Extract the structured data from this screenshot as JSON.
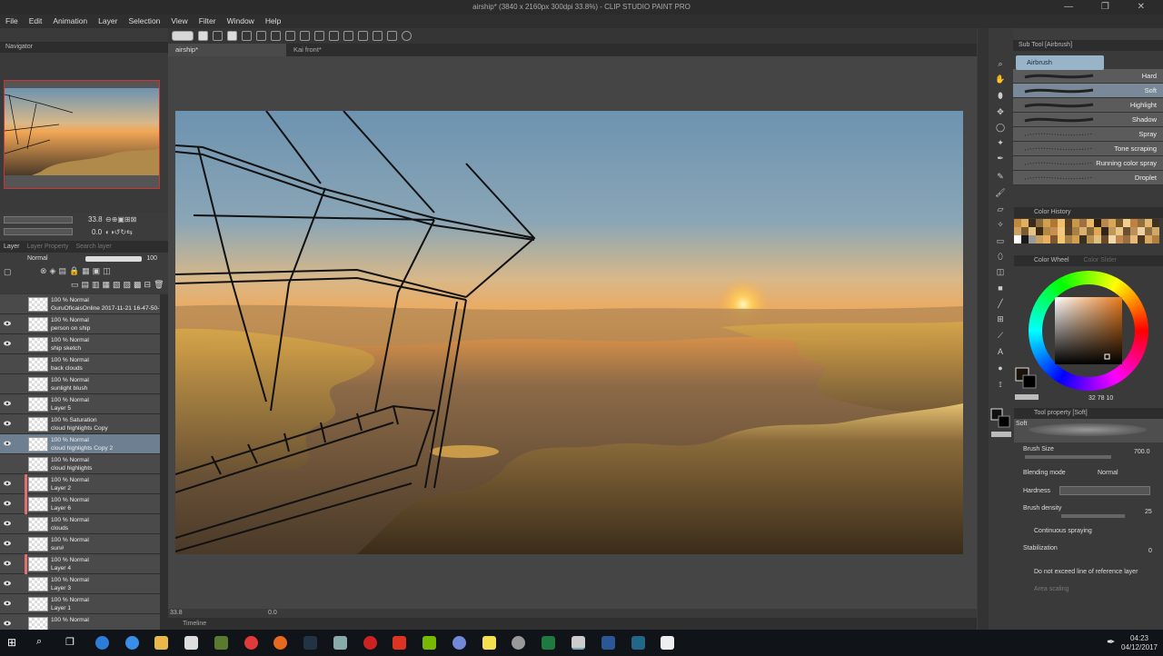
{
  "window": {
    "title": "airship* (3840 x 2160px 300dpi 33.8%) - CLIP STUDIO PAINT PRO",
    "controls": "— ❐ ✕"
  },
  "menu": [
    "File",
    "Edit",
    "Animation",
    "Layer",
    "Selection",
    "View",
    "Filter",
    "Window",
    "Help"
  ],
  "doc_tabs": [
    {
      "label": "airship*",
      "active": true
    },
    {
      "label": "Kai front*",
      "active": false
    }
  ],
  "navigator": {
    "title": "Navigator",
    "zoom": "33.8",
    "angle": "0.0"
  },
  "layers": {
    "tabs": [
      "Layer",
      "Layer Property",
      "Search layer"
    ],
    "blend_mode": "Normal",
    "opacity": "100",
    "items": [
      {
        "pct": "100 % Normal",
        "name": "GuruOficaisOnline 2017-11-21 16-47-50-72 (...",
        "visible": false,
        "selected": false,
        "color": ""
      },
      {
        "pct": "100 % Normal",
        "name": "person on ship",
        "visible": true,
        "selected": false,
        "color": ""
      },
      {
        "pct": "100 % Normal",
        "name": "ship sketch",
        "visible": true,
        "selected": false,
        "color": ""
      },
      {
        "pct": "100 % Normal",
        "name": "back clouds",
        "visible": false,
        "selected": false,
        "color": ""
      },
      {
        "pct": "100 % Normal",
        "name": "sunlight blush",
        "visible": false,
        "selected": false,
        "color": ""
      },
      {
        "pct": "100 % Normal",
        "name": "Layer 5",
        "visible": true,
        "selected": false,
        "color": ""
      },
      {
        "pct": "100 % Saturation",
        "name": "cloud highlights Copy",
        "visible": true,
        "selected": false,
        "color": ""
      },
      {
        "pct": "100 % Normal",
        "name": "cloud highlights Copy 2",
        "visible": true,
        "selected": true,
        "color": ""
      },
      {
        "pct": "100 % Normal",
        "name": "cloud highlights",
        "visible": false,
        "selected": false,
        "color": ""
      },
      {
        "pct": "100 % Normal",
        "name": "Layer 2",
        "visible": true,
        "selected": false,
        "color": "#e07070"
      },
      {
        "pct": "100 % Normal",
        "name": "Layer 6",
        "visible": true,
        "selected": false,
        "color": "#e07070"
      },
      {
        "pct": "100 % Normal",
        "name": "clouds",
        "visible": true,
        "selected": false,
        "color": ""
      },
      {
        "pct": "100 % Normal",
        "name": "sun#",
        "visible": true,
        "selected": false,
        "color": ""
      },
      {
        "pct": "100 % Normal",
        "name": "Layer 4",
        "visible": true,
        "selected": false,
        "color": "#e07070"
      },
      {
        "pct": "100 % Normal",
        "name": "Layer 3",
        "visible": true,
        "selected": false,
        "color": ""
      },
      {
        "pct": "100 % Normal",
        "name": "Layer 1",
        "visible": true,
        "selected": false,
        "color": ""
      },
      {
        "pct": "100 % Normal",
        "name": "",
        "visible": true,
        "selected": false,
        "color": ""
      }
    ]
  },
  "canvas_status": {
    "zoom": "33.8",
    "angle": "0.0"
  },
  "timeline": {
    "label": "Timeline"
  },
  "sub_tool": {
    "header": "Sub Tool [Airbrush]",
    "group": "Airbrush",
    "items": [
      {
        "name": "Hard",
        "active": false
      },
      {
        "name": "Soft",
        "active": true
      },
      {
        "name": "Highlight",
        "active": false
      },
      {
        "name": "Shadow",
        "active": false
      },
      {
        "name": "Spray",
        "active": false
      },
      {
        "name": "Tone scraping",
        "active": false
      },
      {
        "name": "Running color spray",
        "active": false
      },
      {
        "name": "Droplet",
        "active": false
      }
    ]
  },
  "color_history": {
    "header": "Color History",
    "swatches": [
      "#c08a3a",
      "#e0b060",
      "#3a2a1a",
      "#8a6a3a",
      "#d0a050",
      "#b07830",
      "#f0c070",
      "#5a4020",
      "#c89848",
      "#a07040",
      "#e8b868",
      "#302010",
      "#b88850",
      "#d8a858",
      "#7a5828",
      "#f0d090",
      "#c08040",
      "#90703a",
      "#e0b870",
      "#403020",
      "#d0a060",
      "#7a5a30",
      "#e8c080",
      "#3a2810",
      "#b08848",
      "#c89050",
      "#f0c880",
      "#5a4428",
      "#a88040",
      "#d8b070",
      "#8a6838",
      "#e0a850",
      "#302418",
      "#c0985a",
      "#e8c888",
      "#6a5030",
      "#b89058",
      "#f0d0a0",
      "#907040",
      "#d0a868",
      "#ffffff",
      "#1a1a1a",
      "#9a9a9a",
      "#c8a060",
      "#e8b060",
      "#805830",
      "#f0c870",
      "#a88048",
      "#d0a050",
      "#3a3020",
      "#b89050",
      "#e0c080",
      "#6a4a28",
      "#f0d8a8",
      "#c08850",
      "#987040",
      "#e8b878",
      "#4a3820",
      "#d8a860",
      "#b08040"
    ]
  },
  "color_wheel": {
    "header": "Color Wheel",
    "tab2": "Color Slider",
    "hue_color": "#e87a1a",
    "values": "32  78  10"
  },
  "tool_property": {
    "header": "Tool property [Soft]",
    "preset": "Soft",
    "brush_size_label": "Brush Size",
    "brush_size": "700.0",
    "blending_label": "Blending mode",
    "blending": "Normal",
    "hardness_label": "Hardness",
    "density_label": "Brush density",
    "density": "25",
    "continuous_label": "Continuous spraying",
    "stabilization_label": "Stabilization",
    "stabilization": "0",
    "ref_line_label": "Do not exceed line of reference layer",
    "area_label": "Area scaling"
  },
  "taskbar": {
    "time": "04:23",
    "date": "04/12/2017"
  }
}
